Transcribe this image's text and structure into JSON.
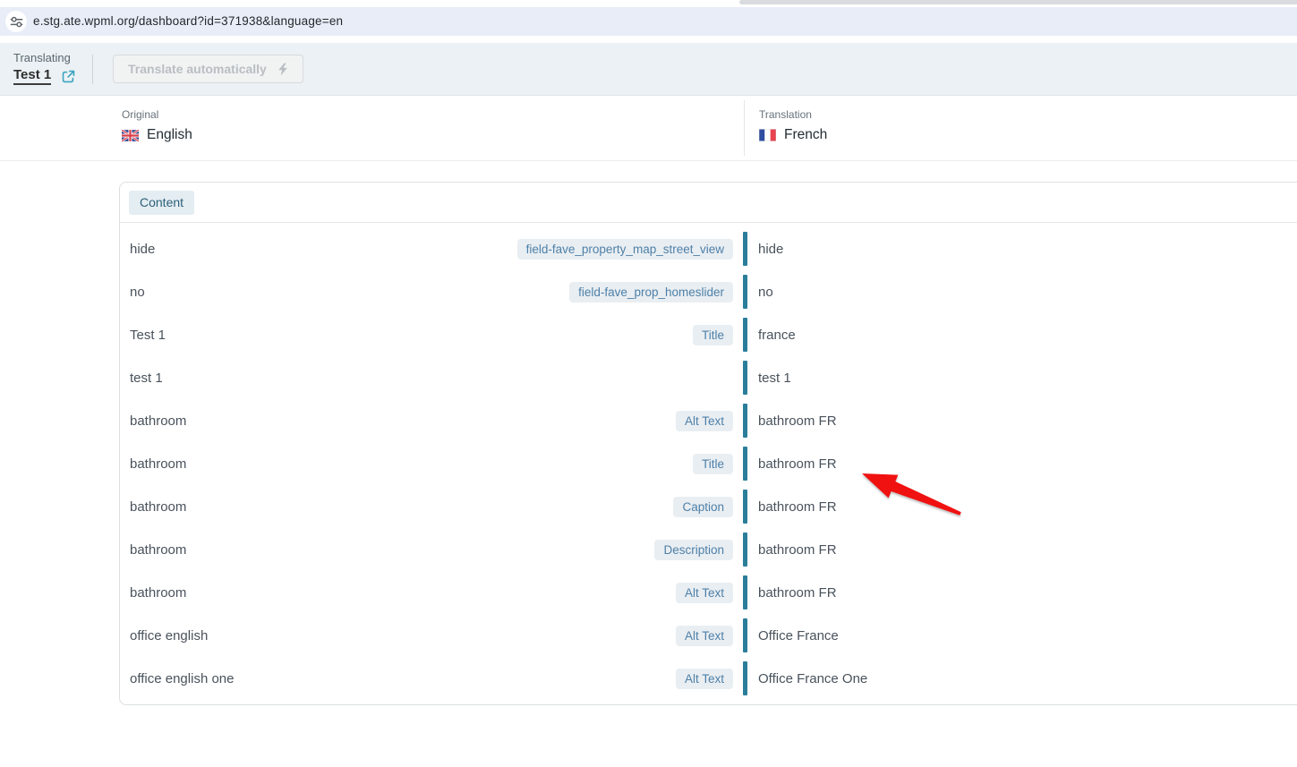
{
  "browser": {
    "url": "e.stg.ate.wpml.org/dashboard?id=371938&language=en",
    "site_icon": "tune-icon"
  },
  "toolbar": {
    "translating_label": "Translating",
    "document_title": "Test 1",
    "external_link_icon": "external-link-icon",
    "translate_button_label": "Translate automatically",
    "translate_button_icon": "lightning-icon",
    "translate_button_state": "disabled"
  },
  "language_bar": {
    "original": {
      "label": "Original",
      "language": "English",
      "flag": "uk-flag"
    },
    "translation": {
      "label": "Translation",
      "language": "French",
      "flag": "france-flag"
    }
  },
  "editor": {
    "tab_label": "Content",
    "rows": [
      {
        "source": "hide",
        "badge": "field-fave_property_map_street_view",
        "translation": "hide"
      },
      {
        "source": "no",
        "badge": "field-fave_prop_homeslider",
        "translation": "no"
      },
      {
        "source": "Test 1",
        "badge": "Title",
        "translation": "france"
      },
      {
        "source": "test 1",
        "badge": "",
        "translation": "test 1"
      },
      {
        "source": "bathroom",
        "badge": "Alt Text",
        "translation": "bathroom FR"
      },
      {
        "source": "bathroom",
        "badge": "Title",
        "translation": "bathroom FR"
      },
      {
        "source": "bathroom",
        "badge": "Caption",
        "translation": "bathroom FR"
      },
      {
        "source": "bathroom",
        "badge": "Description",
        "translation": "bathroom FR"
      },
      {
        "source": "bathroom",
        "badge": "Alt Text",
        "translation": "bathroom FR"
      },
      {
        "source": "office english",
        "badge": "Alt Text",
        "translation": "Office France"
      },
      {
        "source": "office english one",
        "badge": "Alt Text",
        "translation": "Office France One"
      }
    ]
  },
  "annotation": {
    "arrow_color": "#f01111",
    "points_to": "bathroom FR"
  },
  "colors": {
    "urlbar_bg": "#e8edf8",
    "toolbar_bg": "#ebf1f4",
    "accent_teal": "#2a7e9a",
    "badge_bg": "#e9eef2",
    "badge_text": "#4e80a8",
    "tab_bg": "#e4edf2",
    "tab_text": "#2e5f79"
  }
}
